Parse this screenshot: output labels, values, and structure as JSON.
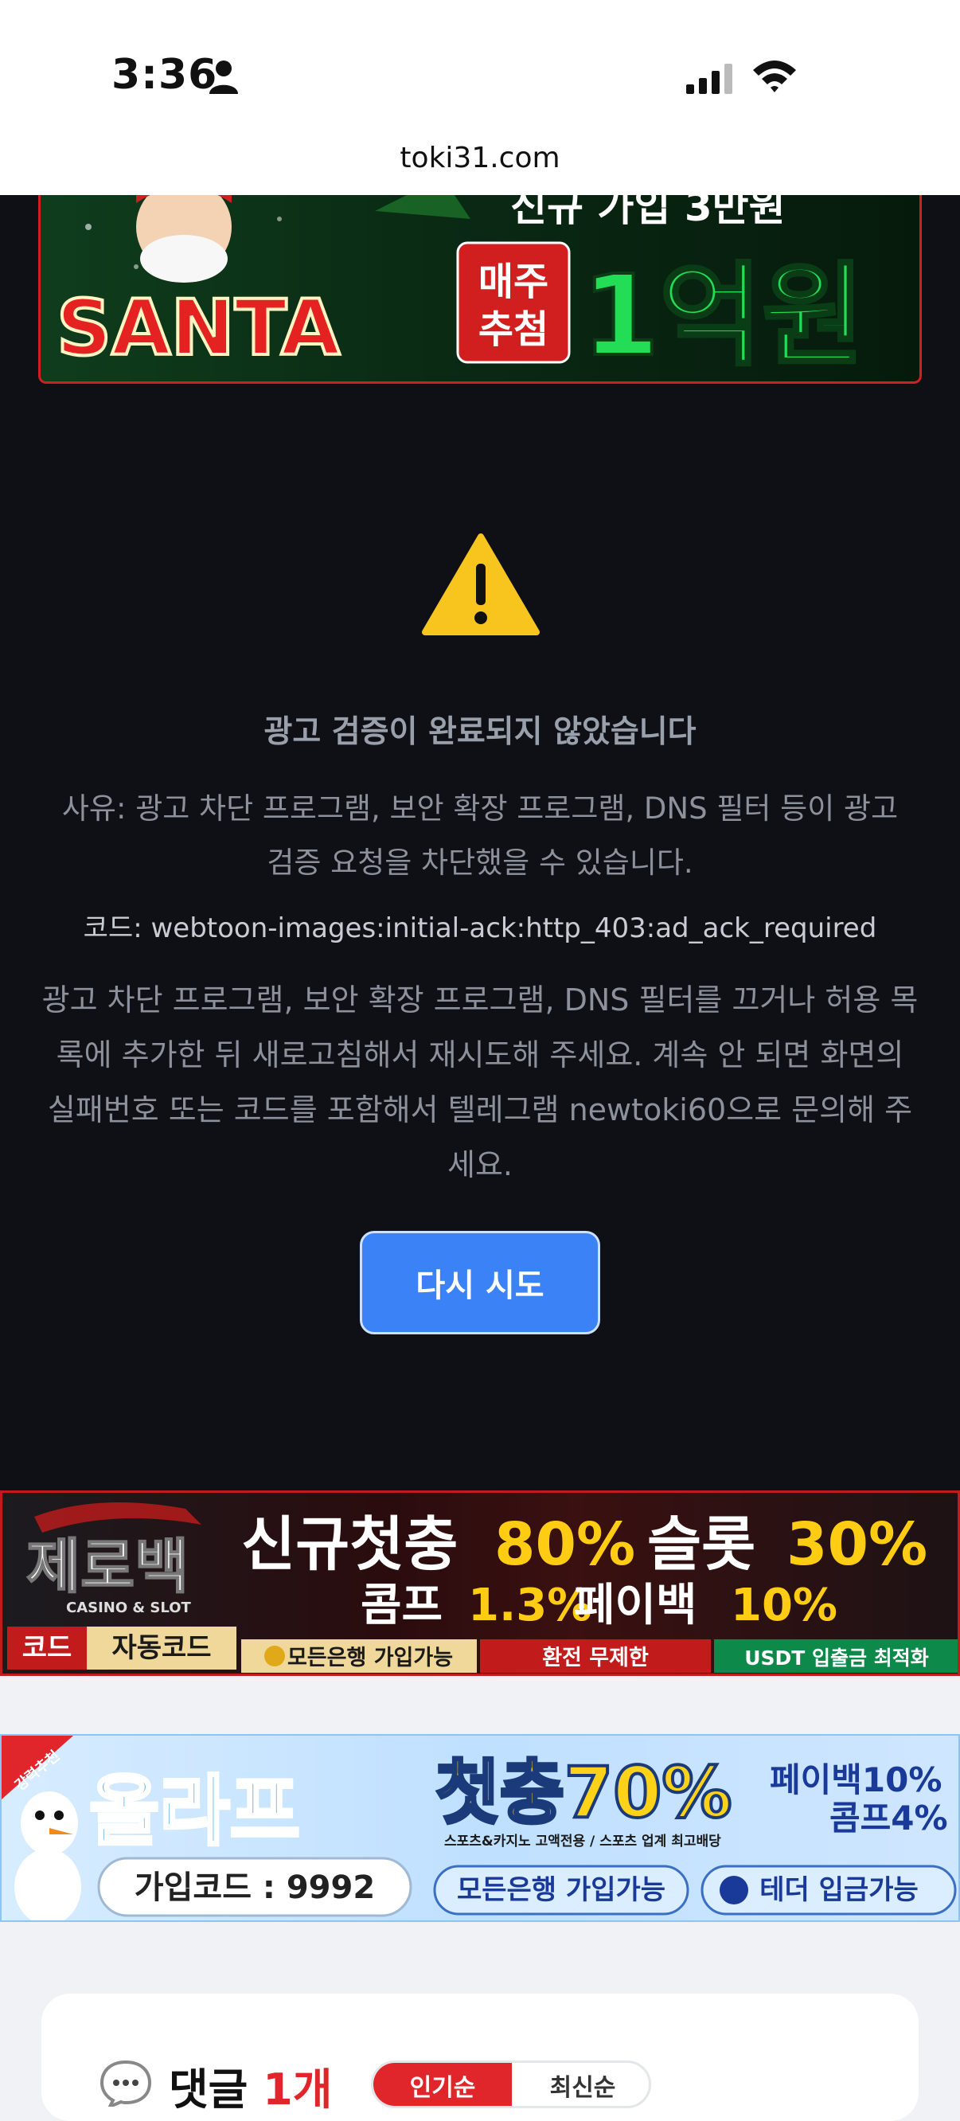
{
  "status_bar": {
    "time": "3:36",
    "icons": [
      "person-icon",
      "signal-icon",
      "wifi-icon"
    ]
  },
  "browser": {
    "url": "toki31.com"
  },
  "ads": {
    "santa": {
      "top_text": "신규 가입 3만원",
      "logo": "SANTA",
      "weekly_draw": "매주\n추첨",
      "prize": "1억원"
    },
    "zeroback": {
      "brand": "제로백",
      "brand_sub": "CASINO & SLOT",
      "headline_a": "신규첫충",
      "headline_a_pct": "80%",
      "headline_b": "슬롯",
      "headline_b_pct": "30%",
      "line2_a": "콤프",
      "line2_a_pct": "1.3%",
      "line2_b": "페이백",
      "line2_b_pct": "10%",
      "code_label": "코드",
      "code_value": "자동코드",
      "tags": [
        "모든은행 가입가능",
        "환전 무제한",
        "USDT 입출금 최적화"
      ]
    },
    "olaf": {
      "ribbon": "강력추천",
      "brand": "올라프",
      "join_code": "가입코드 : 9992",
      "headline": "첫충70%",
      "payback": "페이백10%",
      "comp": "콤프4%",
      "sub": "스포츠&카지노 고액전용 / 스포츠 업계 최고배당",
      "tags": [
        "모든은행 가입가능",
        "테더 입금가능"
      ]
    }
  },
  "error": {
    "title": "광고 검증이 완료되지 않았습니다",
    "reason": "사유: 광고 차단 프로그램, 보안 확장 프로그램, DNS 필터 등이 광고 검증 요청을 차단했을 수 있습니다.",
    "code": "코드: webtoon-images:initial-ack:http_403:ad_ack_required",
    "instructions": "광고 차단 프로그램, 보안 확장 프로그램, DNS 필터를 끄거나 허용 목록에 추가한 뒤 새로고침해서 재시도해 주세요. 계속 안 되면 화면의 실패번호 또는 코드를 포함해서 텔레그램 newtoki60으로 문의해 주세요.",
    "retry_label": "다시 시도"
  },
  "comments": {
    "title": "댓글",
    "count": "1개",
    "sort_options": [
      "인기순",
      "최신순"
    ],
    "active_sort": "인기순"
  },
  "colors": {
    "dark_bg": "#0e1016",
    "accent_blue": "#3b82f6",
    "accent_red": "#e0262b",
    "warning_yellow": "#f7c51e"
  }
}
